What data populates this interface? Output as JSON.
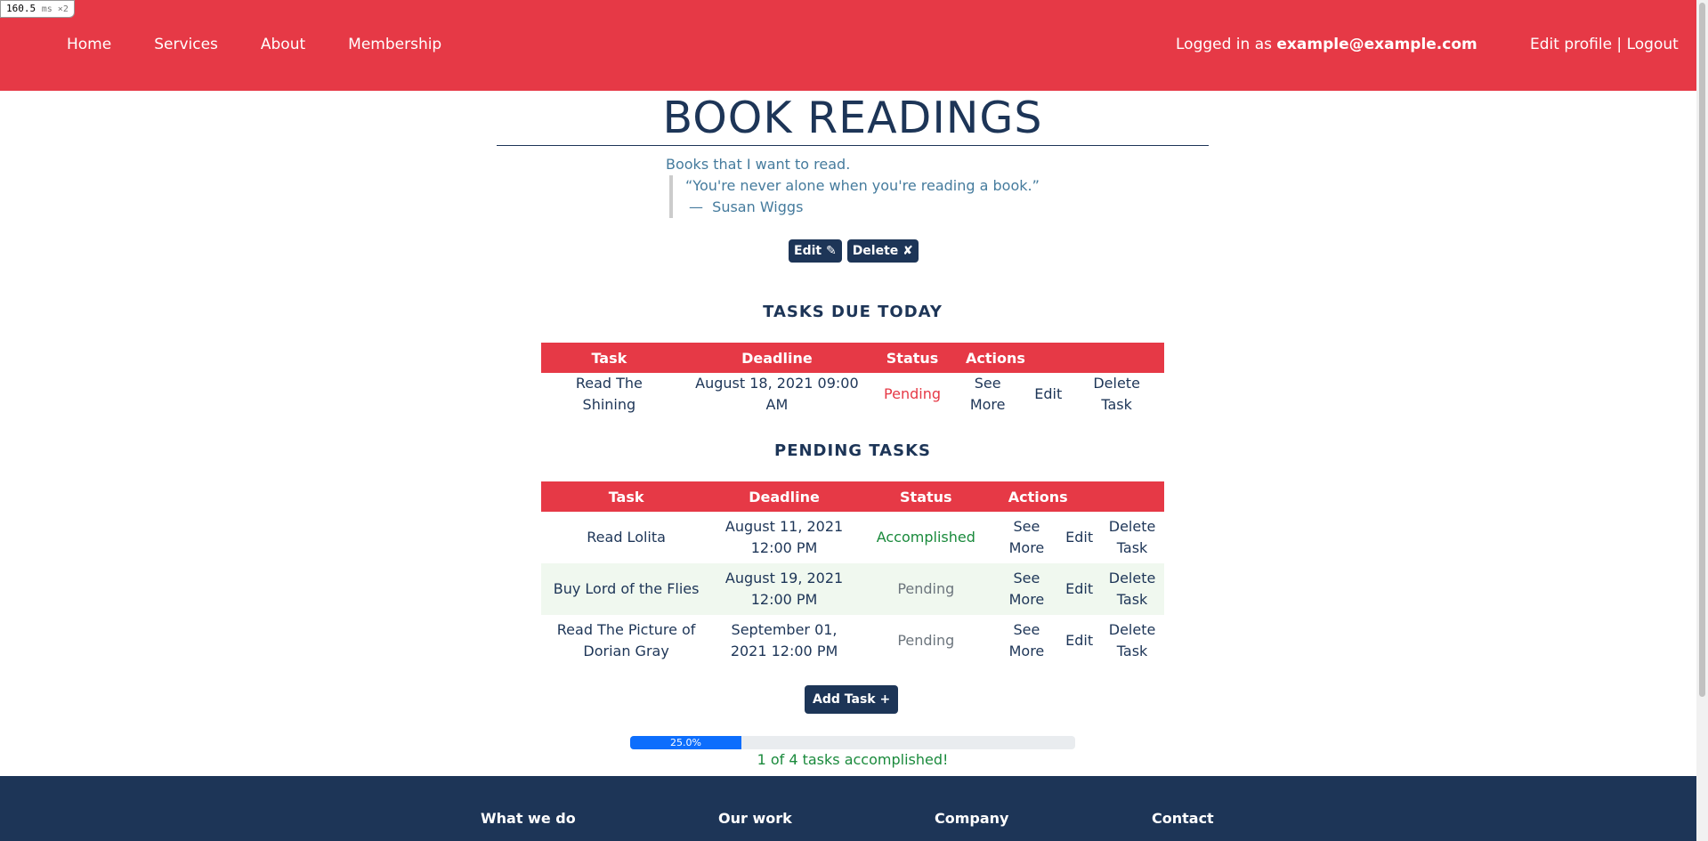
{
  "perf": {
    "value": "160.5",
    "unit": "ms ×2"
  },
  "nav": {
    "links": [
      "Home",
      "Services",
      "About",
      "Membership"
    ],
    "user_prefix": "Logged in as ",
    "user_email": "example@example.com",
    "edit_profile": "Edit profile",
    "separator": " | ",
    "logout": "Logout"
  },
  "list": {
    "title": "BOOK READINGS",
    "description": "Books that I want to read.",
    "quote": "“You're never alone when you're reading a book.”",
    "quote_dash": "—",
    "quote_author": "Susan Wiggs",
    "edit_button": "Edit ✎",
    "delete_button": "Delete ✘"
  },
  "today": {
    "heading": "TASKS DUE TODAY",
    "columns": [
      "Task",
      "Deadline",
      "Status",
      "Actions"
    ],
    "rows": [
      {
        "task": "Read The Shining",
        "deadline": "August 18, 2021 09:00 AM",
        "status": "Pending",
        "see_more": "See More",
        "edit": "Edit",
        "delete": "Delete Task"
      }
    ]
  },
  "pending": {
    "heading": "PENDING TASKS",
    "columns": [
      "Task",
      "Deadline",
      "Status",
      "Actions"
    ],
    "rows": [
      {
        "task": "Read Lolita",
        "deadline": "August 11, 2021 12:00 PM",
        "status": "Accomplished",
        "see_more": "See More",
        "edit": "Edit",
        "delete": "Delete Task"
      },
      {
        "task": "Buy Lord of the Flies",
        "deadline": "August 19, 2021 12:00 PM",
        "status": "Pending",
        "see_more": "See More",
        "edit": "Edit",
        "delete": "Delete Task"
      },
      {
        "task": "Read The Picture of Dorian Gray",
        "deadline": "September 01, 2021 12:00 PM",
        "status": "Pending",
        "see_more": "See More",
        "edit": "Edit",
        "delete": "Delete Task"
      }
    ]
  },
  "add_task_button": "Add Task +",
  "progress": {
    "label": "25.0%",
    "fraction": 0.25,
    "text": "1 of 4 tasks accomplished!"
  },
  "footer": {
    "columns": [
      "What we do",
      "Our work",
      "Company",
      "Contact"
    ]
  },
  "colors": {
    "primary_red": "#e63946",
    "navy": "#1d3557",
    "progress_blue": "#0d6efd",
    "success_green": "#1a8a3c"
  }
}
